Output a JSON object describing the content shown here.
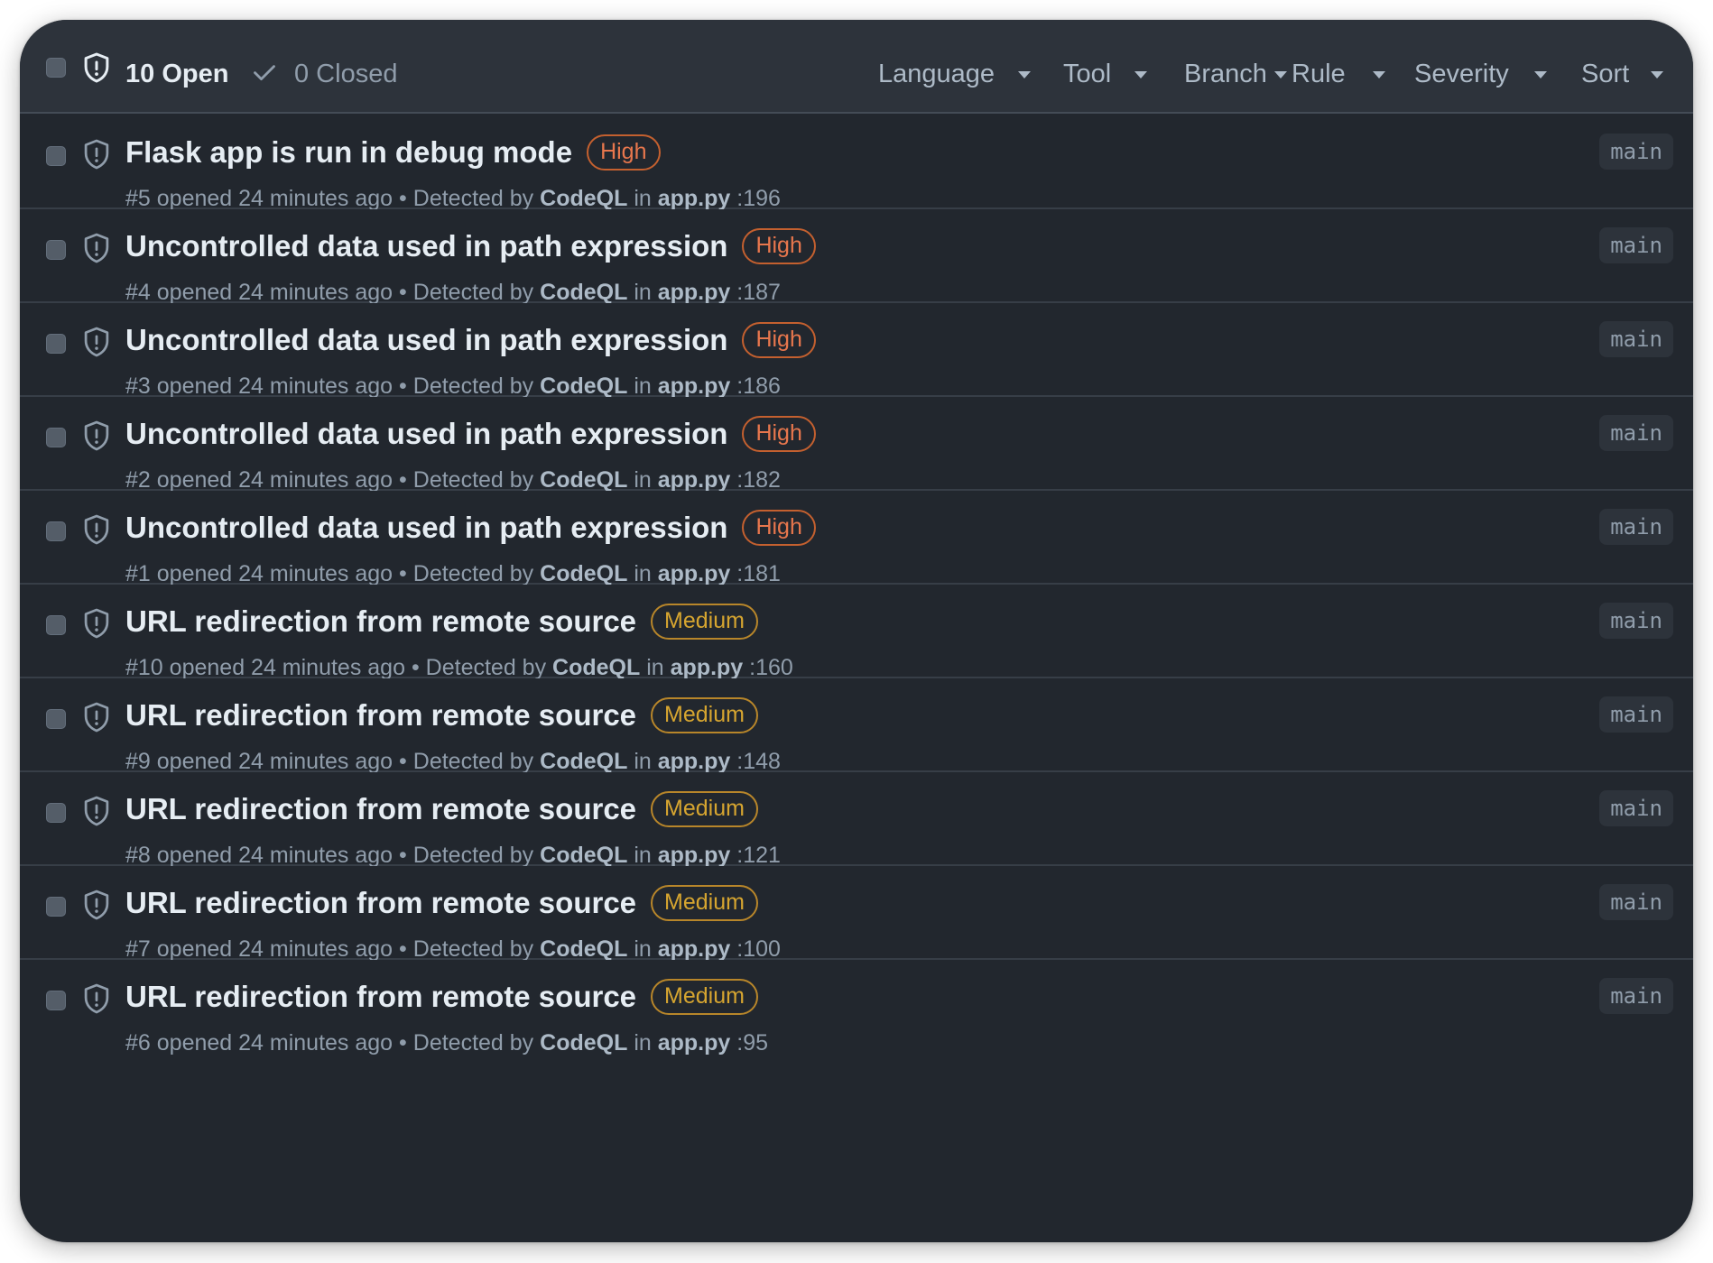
{
  "toolbar": {
    "open_label": "10 Open",
    "closed_label": "0 Closed",
    "filters": [
      "Language",
      "Tool",
      "Branch",
      "Rule",
      "Severity",
      "Sort"
    ]
  },
  "alerts": [
    {
      "title": "Flask app is run in debug mode",
      "severity": "High",
      "number": "#5",
      "opened": "opened 24 minutes ago",
      "detected_prefix": "Detected by",
      "tool": "CodeQL",
      "in_label": "in",
      "file": "app.py",
      "line": ":196",
      "branch": "main"
    },
    {
      "title": "Uncontrolled data used in path expression",
      "severity": "High",
      "number": "#4",
      "opened": "opened 24 minutes ago",
      "detected_prefix": "Detected by",
      "tool": "CodeQL",
      "in_label": "in",
      "file": "app.py",
      "line": ":187",
      "branch": "main"
    },
    {
      "title": "Uncontrolled data used in path expression",
      "severity": "High",
      "number": "#3",
      "opened": "opened 24 minutes ago",
      "detected_prefix": "Detected by",
      "tool": "CodeQL",
      "in_label": "in",
      "file": "app.py",
      "line": ":186",
      "branch": "main"
    },
    {
      "title": "Uncontrolled data used in path expression",
      "severity": "High",
      "number": "#2",
      "opened": "opened 24 minutes ago",
      "detected_prefix": "Detected by",
      "tool": "CodeQL",
      "in_label": "in",
      "file": "app.py",
      "line": ":182",
      "branch": "main"
    },
    {
      "title": "Uncontrolled data used in path expression",
      "severity": "High",
      "number": "#1",
      "opened": "opened 24 minutes ago",
      "detected_prefix": "Detected by",
      "tool": "CodeQL",
      "in_label": "in",
      "file": "app.py",
      "line": ":181",
      "branch": "main"
    },
    {
      "title": "URL redirection from remote source",
      "severity": "Medium",
      "number": "#10",
      "opened": "opened 24 minutes ago",
      "detected_prefix": "Detected by",
      "tool": "CodeQL",
      "in_label": "in",
      "file": "app.py",
      "line": ":160",
      "branch": "main"
    },
    {
      "title": "URL redirection from remote source",
      "severity": "Medium",
      "number": "#9",
      "opened": "opened 24 minutes ago",
      "detected_prefix": "Detected by",
      "tool": "CodeQL",
      "in_label": "in",
      "file": "app.py",
      "line": ":148",
      "branch": "main"
    },
    {
      "title": "URL redirection from remote source",
      "severity": "Medium",
      "number": "#8",
      "opened": "opened 24 minutes ago",
      "detected_prefix": "Detected by",
      "tool": "CodeQL",
      "in_label": "in",
      "file": "app.py",
      "line": ":121",
      "branch": "main"
    },
    {
      "title": "URL redirection from remote source",
      "severity": "Medium",
      "number": "#7",
      "opened": "opened 24 minutes ago",
      "detected_prefix": "Detected by",
      "tool": "CodeQL",
      "in_label": "in",
      "file": "app.py",
      "line": ":100",
      "branch": "main"
    },
    {
      "title": "URL redirection from remote source",
      "severity": "Medium",
      "number": "#6",
      "opened": "opened 24 minutes ago",
      "detected_prefix": "Detected by",
      "tool": "CodeQL",
      "in_label": "in",
      "file": "app.py",
      "line": ":95",
      "branch": "main"
    }
  ],
  "colors": {
    "background": "#22272e",
    "header_background": "#2d333b",
    "severity_high": "#e8774d",
    "severity_medium": "#d6a530"
  },
  "icons": {
    "alert": "shield-icon",
    "closed": "check-icon",
    "dropdown": "caret-down-icon"
  }
}
